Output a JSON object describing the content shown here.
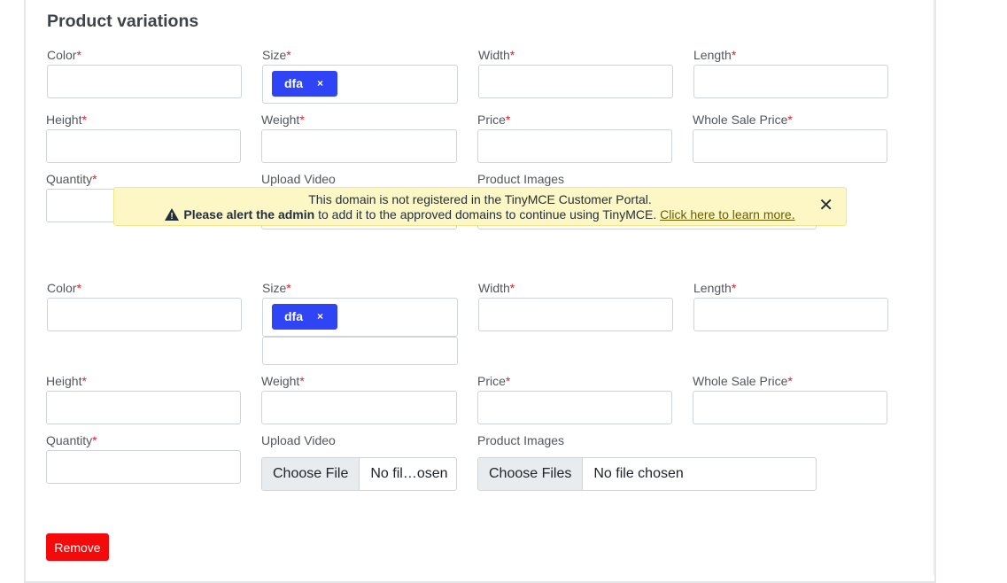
{
  "section": {
    "title": "Product variations"
  },
  "variations": [
    {
      "labels": {
        "color": "Color",
        "size": "Size",
        "width": "Width",
        "length": "Length",
        "height": "Height",
        "weight": "Weight",
        "price": "Price",
        "wholesale": "Whole Sale Price",
        "quantity": "Quantity",
        "upload_video": "Upload Video",
        "product_images": "Product Images"
      },
      "required_mark": "*",
      "size_tag": {
        "text": "dfa",
        "remove": "×"
      }
    },
    {
      "labels": {
        "color": "Color",
        "size": "Size",
        "width": "Width",
        "length": "Length",
        "height": "Height",
        "weight": "Weight",
        "price": "Price",
        "wholesale": "Whole Sale Price",
        "quantity": "Quantity",
        "upload_video": "Upload Video",
        "product_images": "Product Images"
      },
      "required_mark": "*",
      "size_tag": {
        "text": "dfa",
        "remove": "×"
      },
      "video_file": {
        "button": "Choose File",
        "status": "No fil…osen"
      },
      "images_file": {
        "button": "Choose Files",
        "status": "No file chosen"
      }
    }
  ],
  "banner": {
    "line1": "This domain is not registered in the TinyMCE Customer Portal.",
    "bold": "Please alert the admin",
    "line2": " to add it to the approved domains to continue using TinyMCE. ",
    "link": "Click here to learn more.",
    "close": "✕",
    "icon": "warning-icon"
  },
  "remove_button": {
    "label": "Remove",
    "color": "#f40a0a"
  },
  "colors": {
    "tag": "#2f45f5",
    "required": "#e0202a",
    "banner_bg": "#fdf7c6"
  }
}
